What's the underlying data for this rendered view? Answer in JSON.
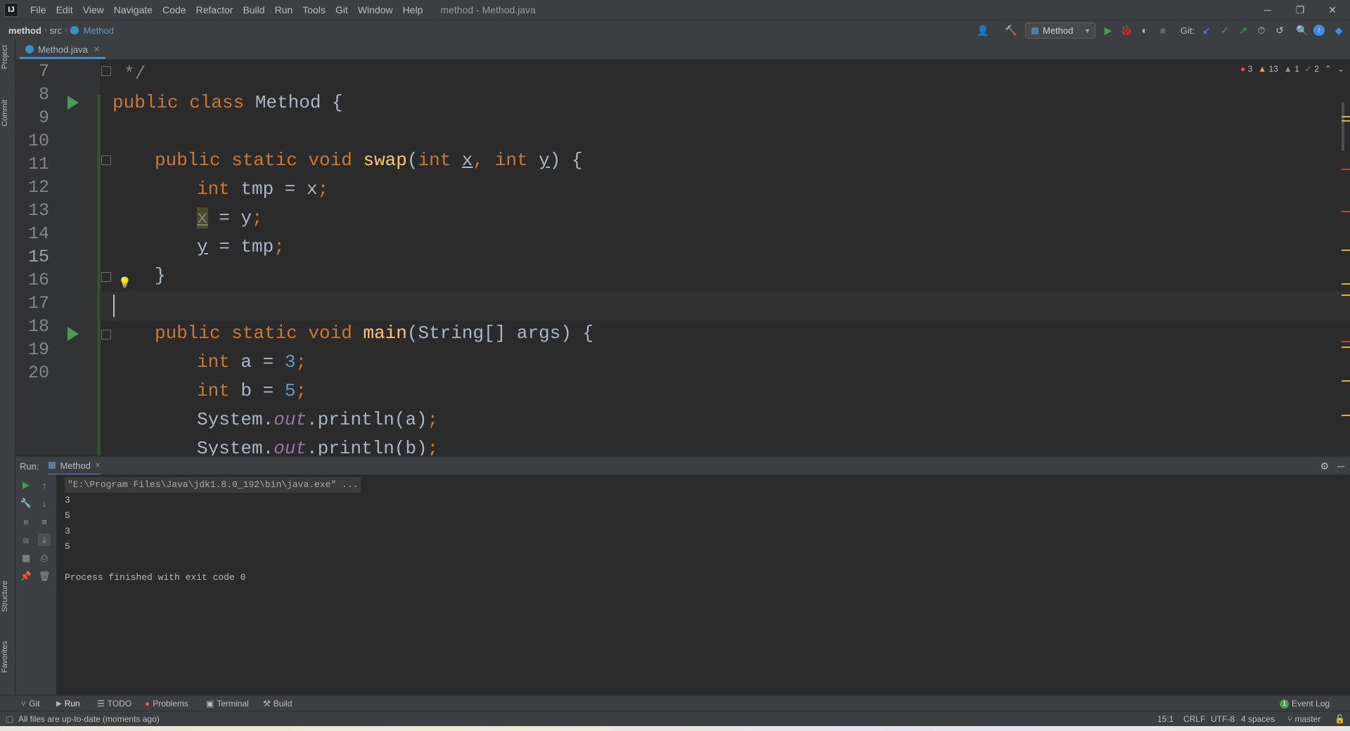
{
  "window": {
    "title": "method - Method.java",
    "menu": [
      "File",
      "Edit",
      "View",
      "Navigate",
      "Code",
      "Refactor",
      "Build",
      "Run",
      "Tools",
      "Git",
      "Window",
      "Help"
    ],
    "controls": {
      "minimize": "─",
      "restore": "❐",
      "close": "✕"
    }
  },
  "breadcrumbs": [
    "method",
    "src",
    "Method"
  ],
  "toolbar": {
    "run_config": "Method",
    "git_label": "Git:"
  },
  "left_strip": {
    "project": "Project",
    "commit": "Commit",
    "structure": "Structure",
    "favorites": "Favorites"
  },
  "editor": {
    "tab_label": "Method.java",
    "inspections": {
      "errors": "3",
      "warnings": "13",
      "weak_warnings": "1",
      "typos": "2"
    },
    "line_numbers": [
      "7",
      "8",
      "9",
      "10",
      "11",
      "12",
      "13",
      "14",
      "15",
      "16",
      "17",
      "18",
      "19",
      "20"
    ],
    "code": {
      "l7": "*/",
      "l8_kw": "public class",
      "l8_name": " Method {",
      "l10_kw1": "public static void",
      "l10_fn": "swap",
      "l10_p1": "(",
      "l10_kw2": "int",
      "l10_x": "x",
      "l10_comma": ",",
      "l10_kw3": "int",
      "l10_y": "y",
      "l10_end": ") {",
      "l11_kw": "int",
      "l11_rest": " tmp = x",
      "l11_semi": ";",
      "l12_x": "x",
      "l12_rest": " = y",
      "l12_semi": ";",
      "l13_y": "y",
      "l13_rest": " = tmp",
      "l13_semi": ";",
      "l14": "}",
      "l16_kw": "public static void",
      "l16_fn": "main",
      "l16_rest": "(String[] args) {",
      "l17_kw": "int",
      "l17_rest": " a = ",
      "l17_num": "3",
      "l17_semi": ";",
      "l18_kw": "int",
      "l18_rest": " b = ",
      "l18_num": "5",
      "l18_semi": ";",
      "l19_a": "System.",
      "l19_out": "out",
      "l19_b": ".println(a)",
      "l19_semi": ";",
      "l20_a": "System.",
      "l20_out": "out",
      "l20_b": ".println(b)",
      "l20_semi": ";"
    }
  },
  "run_panel": {
    "label": "Run:",
    "tab": "Method",
    "command": "\"E:\\Program Files\\Java\\jdk1.8.0_192\\bin\\java.exe\" ...",
    "output": [
      "3",
      "5",
      "3",
      "5"
    ],
    "finished": "Process finished with exit code 0"
  },
  "tool_tabs": [
    "Git",
    "Run",
    "TODO",
    "Problems",
    "Terminal",
    "Build"
  ],
  "event_log": {
    "count": "1",
    "label": "Event Log"
  },
  "status": {
    "message": "All files are up-to-date (moments ago)",
    "position": "15:1",
    "line_sep": "CRLF",
    "encoding": "UTF-8",
    "indent": "4 spaces",
    "branch": "master"
  },
  "colors": {
    "keyword": "#cc7832",
    "function": "#ffc66d",
    "number": "#6897bb",
    "static_field": "#9876aa",
    "run": "#499c54"
  }
}
